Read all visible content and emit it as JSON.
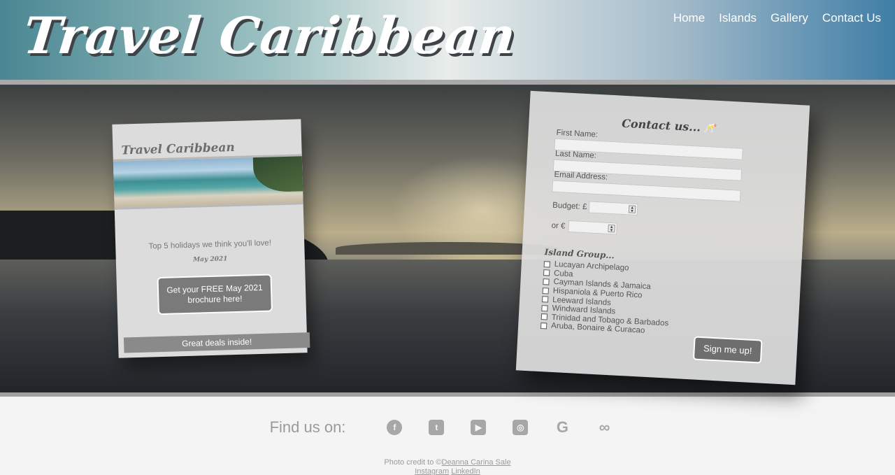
{
  "header": {
    "logo": "Travel Caribbean",
    "nav": [
      "Home",
      "Islands",
      "Gallery",
      "Contact Us"
    ]
  },
  "brochure": {
    "title": "Travel Caribbean",
    "tagline": "Top 5 holidays we think you'll love!",
    "date": "May 2021",
    "button": "Get your FREE May 2021 brochure here!",
    "footer": "Great deals inside!"
  },
  "contact": {
    "title": "Contact us...",
    "first_name_label": "First Name:",
    "last_name_label": "Last Name:",
    "email_label": "Email Address:",
    "budget_label": "Budget: £",
    "or_label": "or €",
    "group_title": "Island Group...",
    "options": [
      "Lucayan Archipelago",
      "Cuba",
      "Cayman Islands & Jamaica",
      "Hispaniola & Puerto Rico",
      "Leeward Islands",
      "Windward Islands",
      "Trinidad and Tobago & Barbados",
      "Aruba, Bonaire & Curacao"
    ],
    "submit": "Sign me up!"
  },
  "footer": {
    "find_us": "Find us on:",
    "social_icons": [
      "facebook-icon",
      "twitter-icon",
      "youtube-icon",
      "instagram-icon",
      "google-icon",
      "tripadvisor-icon"
    ],
    "credit_prefix": "Photo credit to ©",
    "credit_name": "Deanna Carina Sale",
    "credit_instagram": "Instagram",
    "credit_linkedin": "LinkedIn"
  },
  "colors": {
    "header_left": "#4a8793",
    "header_right": "#3f7ea6",
    "button_gray": "#7a7a7a"
  }
}
